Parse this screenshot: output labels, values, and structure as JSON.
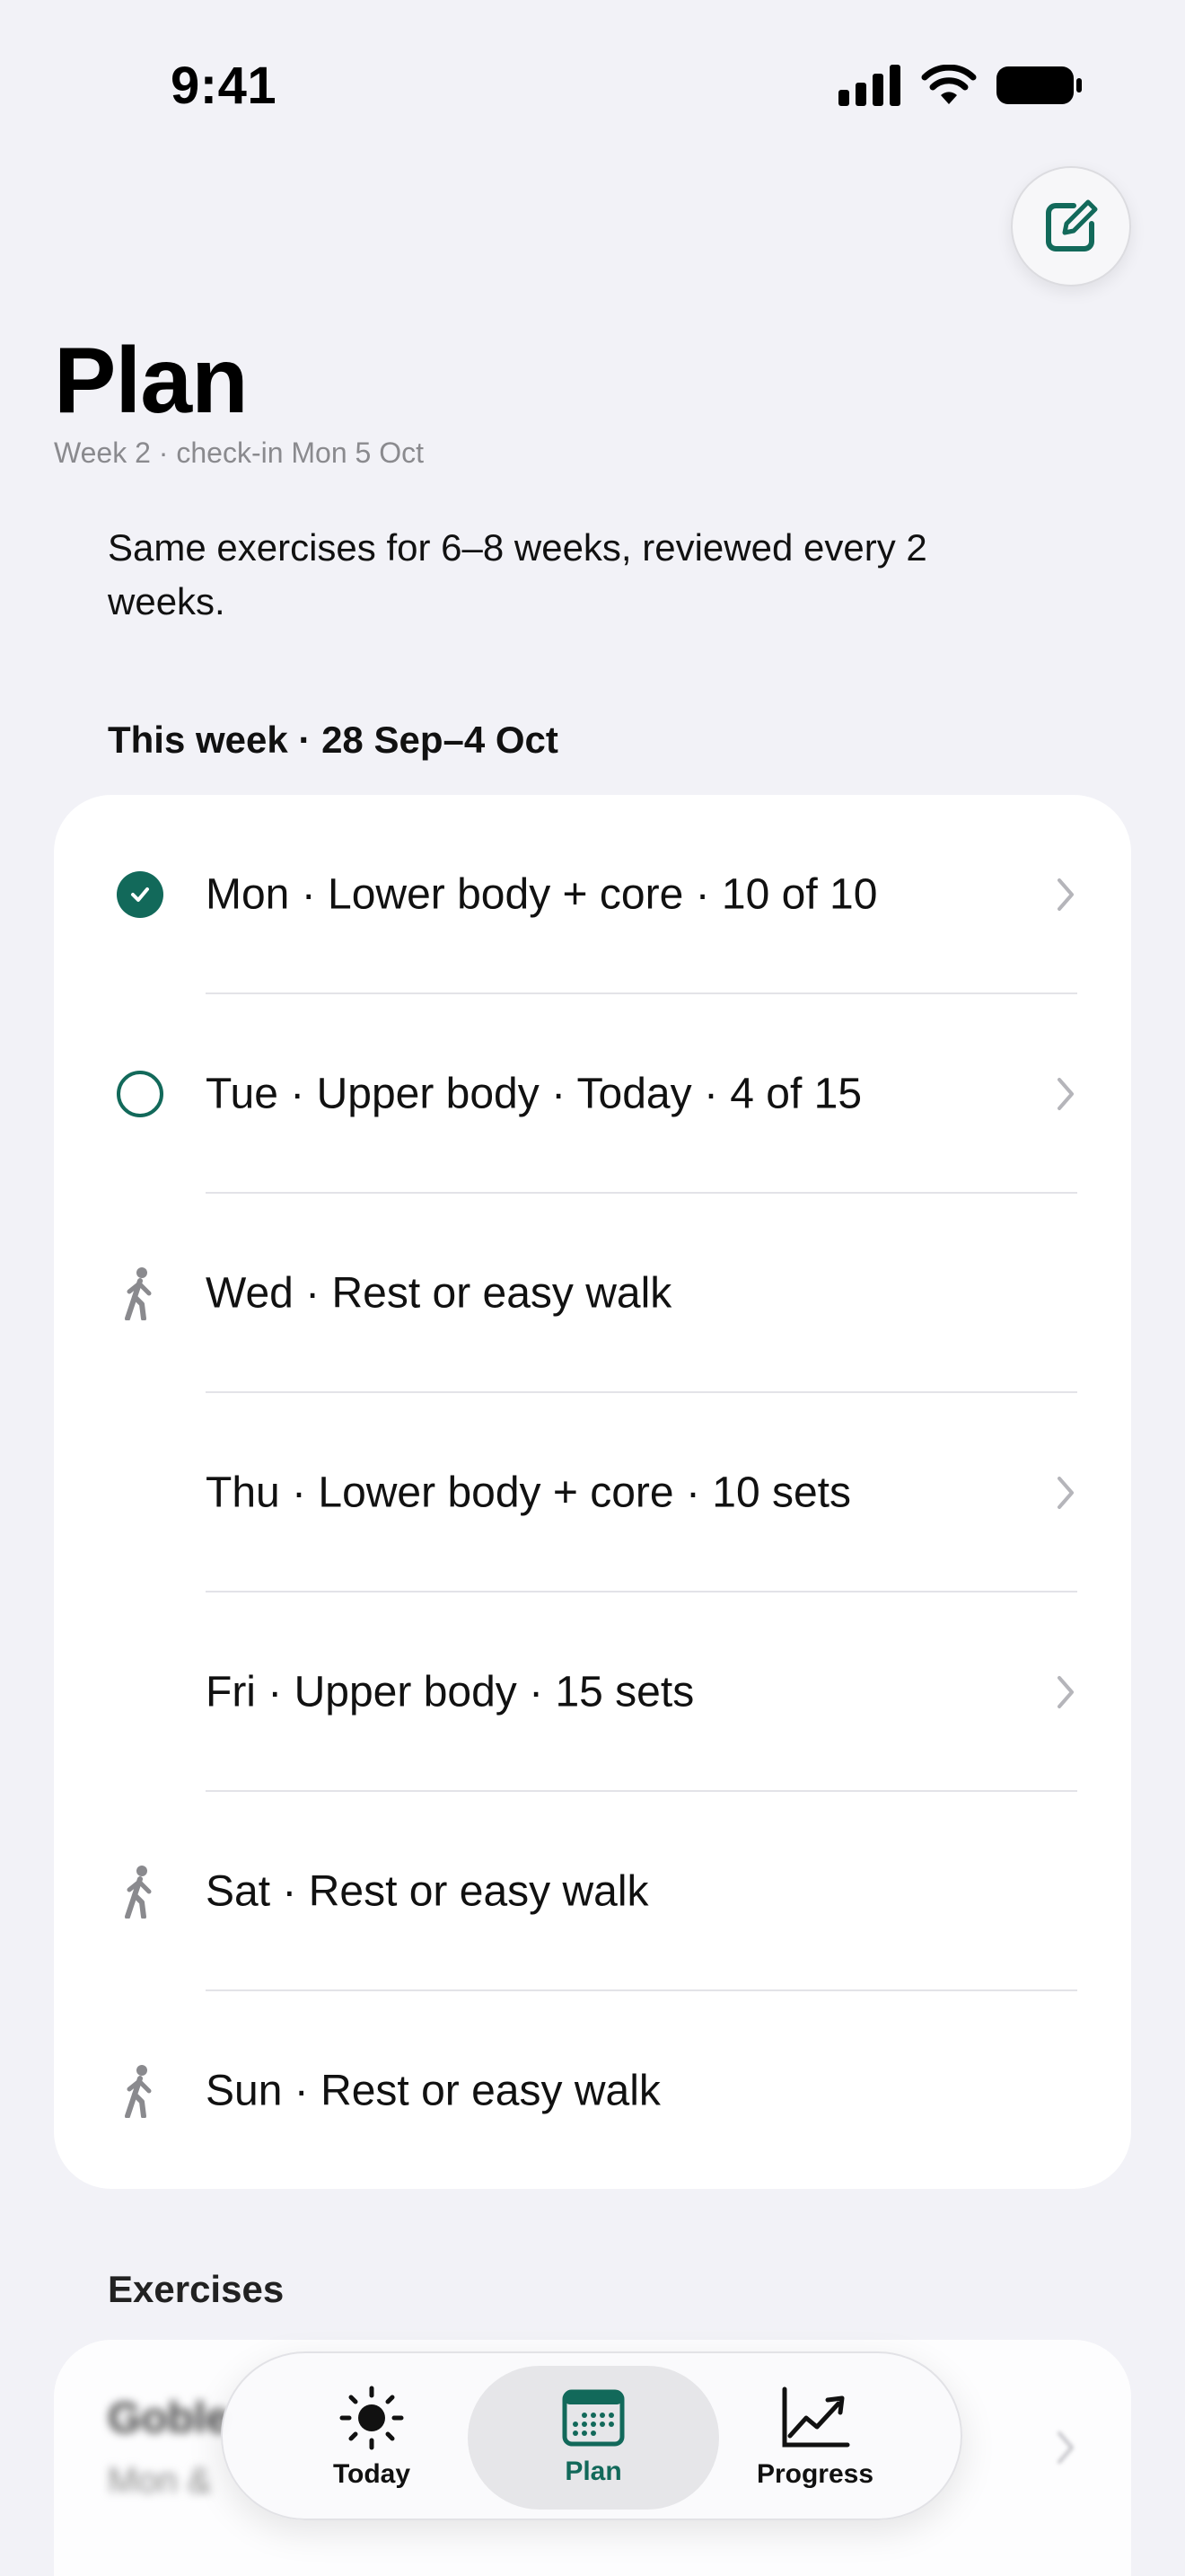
{
  "status_bar": {
    "time": "9:41"
  },
  "header": {
    "title": "Plan",
    "subtitle": "Week 2 · check-in Mon 5 Oct",
    "intro": "Same exercises for 6–8 weeks, reviewed every 2 weeks."
  },
  "week": {
    "header": "This week · 28 Sep–4 Oct",
    "days": [
      {
        "label": "Mon · Lower body + core · 10 of 10",
        "status": "completed",
        "has_chevron": true
      },
      {
        "label": "Tue · Upper body · Today · 4 of 15",
        "status": "in-progress",
        "has_chevron": true
      },
      {
        "label": "Wed · Rest or easy walk",
        "status": "rest",
        "has_chevron": false
      },
      {
        "label": "Thu · Lower body + core · 10 sets",
        "status": "upcoming",
        "has_chevron": true
      },
      {
        "label": "Fri · Upper body · 15 sets",
        "status": "upcoming",
        "has_chevron": true
      },
      {
        "label": "Sat · Rest or easy walk",
        "status": "rest",
        "has_chevron": false
      },
      {
        "label": "Sun · Rest or easy walk",
        "status": "rest",
        "has_chevron": false
      }
    ]
  },
  "exercises": {
    "header": "Exercises",
    "first_item_name": "Goble",
    "first_item_sub": "Mon &"
  },
  "tabbar": {
    "tabs": [
      {
        "label": "Today",
        "icon": "sun-icon",
        "active": false
      },
      {
        "label": "Plan",
        "icon": "calendar-icon",
        "active": true
      },
      {
        "label": "Progress",
        "icon": "chart-icon",
        "active": false
      }
    ]
  },
  "colors": {
    "accent": "#12695a",
    "background": "#f2f2f7",
    "secondary_text": "#8a8a8e"
  }
}
